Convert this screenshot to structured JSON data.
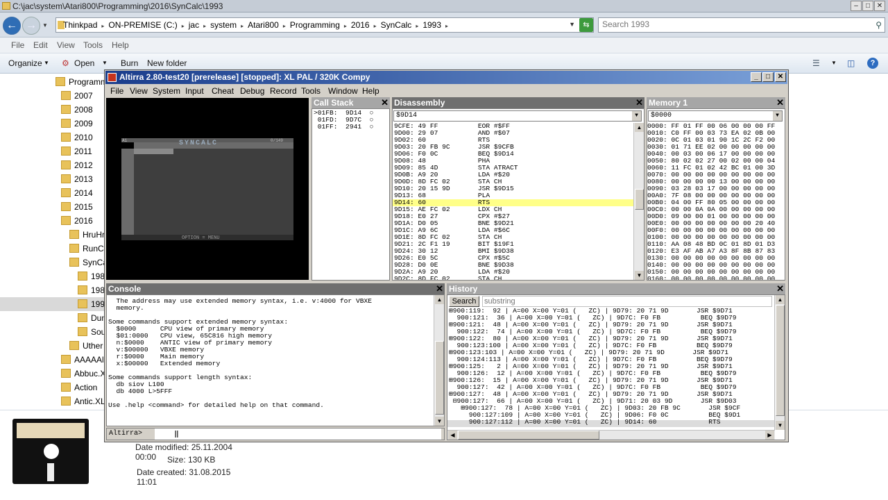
{
  "explorer": {
    "title": "C:\\jac\\system\\Atari800\\Programming\\2016\\SynCalc\\1993",
    "breadcrumb": [
      "Thinkpad",
      "ON-PREMISE (C:)",
      "jac",
      "system",
      "Atari800",
      "Programming",
      "2016",
      "SynCalc",
      "1993"
    ],
    "search_placeholder": "Search 1993",
    "menu": [
      "File",
      "Edit",
      "View",
      "Tools",
      "Help"
    ],
    "toolbar": {
      "organize": "Organize",
      "open": "Open",
      "burn": "Burn",
      "new_folder": "New folder"
    },
    "tree": [
      {
        "label": "Programm"
      },
      {
        "label": "2007"
      },
      {
        "label": "2008"
      },
      {
        "label": "2009"
      },
      {
        "label": "2010"
      },
      {
        "label": "2011"
      },
      {
        "label": "2012"
      },
      {
        "label": "2013"
      },
      {
        "label": "2014"
      },
      {
        "label": "2015"
      },
      {
        "label": "2016"
      },
      {
        "label": "HruHr"
      },
      {
        "label": "RunC"
      },
      {
        "label": "SynCa"
      },
      {
        "label": "198"
      },
      {
        "label": "198"
      },
      {
        "label": "199"
      },
      {
        "label": "Dun"
      },
      {
        "label": "Sou"
      },
      {
        "label": "Uther"
      },
      {
        "label": "AAAAAl"
      },
      {
        "label": "Abbuc.X"
      },
      {
        "label": "Action"
      },
      {
        "label": "Antic.XL"
      }
    ],
    "details": {
      "modified": "Date modified: 25.11.2004 00:00",
      "size": "Size: 130 KB",
      "created": "Date created: 31.08.2015 11:01"
    }
  },
  "altirra": {
    "title": "Altirra 2.80-test20 [prerelease] [stopped]: XL PAL / 320K Compy",
    "menu": [
      "File",
      "View",
      "System",
      "Input",
      "Cheat",
      "Debug",
      "Record",
      "Tools",
      "Window",
      "Help"
    ],
    "screen": {
      "brand": "SYNCALC",
      "footer": "OPTION = MENU",
      "cell": "A1",
      "mem": "0/149"
    },
    "callstack": {
      "title": "Call Stack",
      "lines": [
        ">01FB:  9D14  ○",
        " 01FD:  9D7C  ○",
        " 01FF:  2941  ○"
      ]
    },
    "disasm": {
      "title": "Disassembly",
      "address": "$9D14",
      "highlight_index": 11,
      "lines": [
        "9CFE: 49 FF          EOR #$FF",
        "9D00: 29 07          AND #$07",
        "9D02: 60             RTS",
        "9D03: 20 FB 9C       JSR $9CFB",
        "9D06: F0 0C          BEQ $9D14",
        "9D08: 48             PHA",
        "9D09: 85 4D          STA ATRACT",
        "9D0B: A9 20          LDA #$20",
        "9D0D: 8D FC 02       STA CH",
        "9D10: 20 15 9D       JSR $9D15",
        "9D13: 68             PLA",
        "9D14: 60             RTS",
        "9D15: AE FC 02       LDX CH",
        "9D18: E0 27          CPX #$27",
        "9D1A: D0 05          BNE $9D21",
        "9D1C: A9 6C          LDA #$6C",
        "9D1E: 8D FC 02       STA CH",
        "9D21: 2C F1 19       BIT $19F1",
        "9D24: 30 12          BMI $9D38",
        "9D26: E0 5C          CPX #$5C",
        "9D28: D0 0E          BNE $9D38",
        "9D2A: A9 20          LDA #$20",
        "9D2C: 8D FC 02       STA CH"
      ]
    },
    "memory": {
      "title": "Memory 1",
      "address": "$0000",
      "lines": [
        "0000: FF 01 FF 00 06 00 00 00 FF",
        "0010: C0 FF 00 03 73 EA 02 0B 00",
        "0020: 0C 01 03 01 90 1C 2C F2 00",
        "0030: 01 71 EE 02 00 00 00 00 00",
        "0040: 00 03 00 06 17 00 00 00 00",
        "0050: 80 02 02 27 00 02 00 00 04",
        "0060: 11 FC 01 02 42 BC 01 00 3D",
        "0070: 00 00 00 00 00 00 00 00 00",
        "0080: 00 00 00 00 13 00 00 00 00",
        "0090: 03 28 03 17 00 00 00 00 00",
        "00A0: 7F 08 00 00 00 00 00 00 00",
        "00B0: 04 00 FF 80 05 00 00 00 00",
        "00C0: 00 00 0A 0A 00 00 00 00 00",
        "00D0: 09 00 00 01 00 00 00 00 00",
        "00E0: 00 00 00 00 00 00 00 20 40",
        "00F0: 00 00 00 00 00 00 00 00 00",
        "0100: 00 00 00 00 00 00 00 00 00",
        "0110: AA 08 48 BD 0C 01 8D 01 D3",
        "0120: E3 AF AB A7 A3 8F 8B 87 83",
        "0130: 00 00 00 00 00 00 00 00 00",
        "0140: 00 00 00 00 00 00 00 00 00",
        "0150: 00 00 00 00 00 00 00 00 00",
        "0160: 00 00 00 00 00 00 00 00 00"
      ]
    },
    "console": {
      "title": "Console",
      "prompt": "Altirra>",
      "lines": [
        "  The address may use extended memory syntax, i.e. v:4000 for VBXE",
        "  memory.",
        "",
        "Some commands support extended memory syntax:",
        "  $0000      CPU view of primary memory",
        "  $01:0000   CPU view, 65C816 high memory",
        "  n:$0000    ANTIC view of primary memory",
        "  v:$00000   VBXE memory",
        "  r:$0000    Main memory",
        "  x:$00000   Extended memory",
        "",
        "Some commands support length syntax:",
        "  db siov L100",
        "  db 4000 L>5FFF",
        "",
        "Use .help <command> for detailed help on that command."
      ]
    },
    "history": {
      "title": "History",
      "search_button": "Search",
      "search_placeholder": "substring",
      "lines": [
        "⊞900:119:  92 | A=00 X=00 Y=01 (   ZC) | 9D79: 20 71 9D       JSR $9D71",
        "  900:121:  36 | A=00 X=00 Y=01 (   ZC) | 9D7C: F0 FB          BEQ $9D79",
        "⊞900:121:  48 | A=00 X=00 Y=01 (   ZC) | 9D79: 20 71 9D       JSR $9D71",
        "  900:122:  74 | A=00 X=00 Y=01 (   ZC) | 9D7C: F0 FB          BEQ $9D79",
        "⊞900:122:  80 | A=00 X=00 Y=01 (   ZC) | 9D79: 20 71 9D       JSR $9D71",
        "  900:123:100 | A=00 X=00 Y=01 (   ZC) | 9D7C: F0 FB          BEQ $9D79",
        "⊞900:123:103 | A=00 X=00 Y=01 (   ZC) | 9D79: 20 71 9D       JSR $9D71",
        "  900:124:113 | A=00 X=00 Y=01 (   ZC) | 9D7C: F0 FB          BEQ $9D79",
        "⊞900:125:   2 | A=00 X=00 Y=01 (   ZC) | 9D79: 20 71 9D       JSR $9D71",
        "  900:126:  12 | A=00 X=00 Y=01 (   ZC) | 9D7C: F0 FB          BEQ $9D79",
        "⊞900:126:  15 | A=00 X=00 Y=01 (   ZC) | 9D79: 20 71 9D       JSR $9D71",
        "  900:127:  42 | A=00 X=00 Y=01 (   ZC) | 9D7C: F0 FB          BEQ $9D79",
        "⊞900:127:  48 | A=00 X=00 Y=01 (   ZC) | 9D79: 20 71 9D       JSR $9D71",
        " ⊟900:127:  66 | A=00 X=00 Y=01 (   ZC) | 9D71: 20 03 9D       JSR $9D03",
        "   ⊞900:127:  78 | A=00 X=00 Y=01 (   ZC) | 9D03: 20 FB 9C       JSR $9CF",
        "     900:127:109 | A=00 X=00 Y=01 (   ZC) | 9D06: F0 0C          BEQ $9D1",
        "     900:127:112 | A=00 X=00 Y=01 (   ZC) | 9D14: 60             RTS"
      ]
    }
  }
}
